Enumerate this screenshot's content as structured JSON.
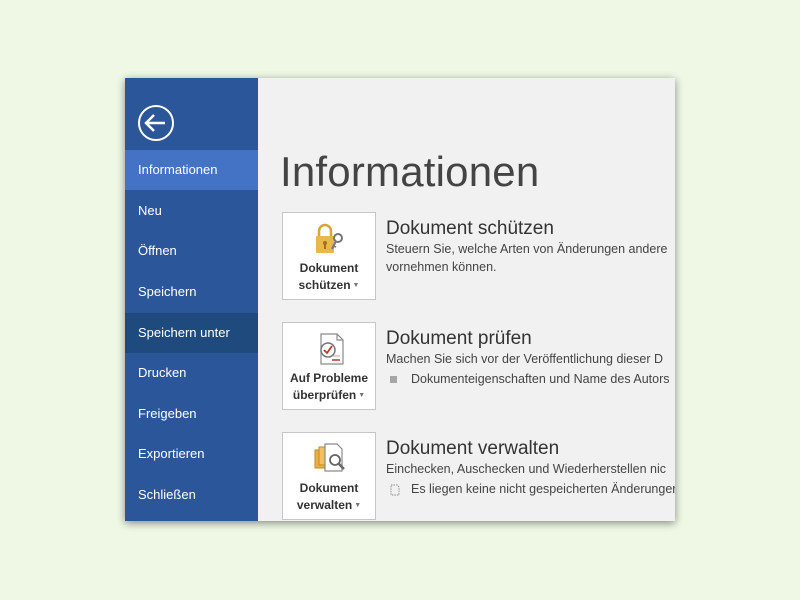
{
  "sidebar": {
    "items": [
      {
        "label": "Informationen"
      },
      {
        "label": "Neu"
      },
      {
        "label": "Öffnen"
      },
      {
        "label": "Speichern"
      },
      {
        "label": "Speichern unter"
      },
      {
        "label": "Drucken"
      },
      {
        "label": "Freigeben"
      },
      {
        "label": "Exportieren"
      },
      {
        "label": "Schließen"
      }
    ],
    "active_index": 0,
    "highlighted_index": 4,
    "back_icon": "back-arrow-icon"
  },
  "main": {
    "title": "Informationen",
    "sections": [
      {
        "tile_line1": "Dokument",
        "tile_line2": "schützen",
        "title": "Dokument schützen",
        "desc_line1": "Steuern Sie, welche Arten von Änderungen andere",
        "desc_line2": "vornehmen können.",
        "icon": "lock-key-icon"
      },
      {
        "tile_line1": "Auf Probleme",
        "tile_line2": "überprüfen",
        "title": "Dokument prüfen",
        "desc_line1": "Machen Sie sich vor der Veröffentlichung dieser D",
        "bullet": "Dokumenteigenschaften und Name des Autors",
        "icon": "inspect-document-icon"
      },
      {
        "tile_line1": "Dokument",
        "tile_line2": "verwalten",
        "title": "Dokument verwalten",
        "desc_line1": "Einchecken, Auschecken und Wiederherstellen nic",
        "bullet": "Es liegen keine nicht gespeicherten Änderungen",
        "icon": "manage-documents-icon"
      }
    ]
  },
  "colors": {
    "sidebar": "#2b579a",
    "active_item": "#4472c4",
    "highlighted_item": "#1f4a7e",
    "content_bg": "#f1f1f1",
    "page_bg": "#eef8e4"
  }
}
